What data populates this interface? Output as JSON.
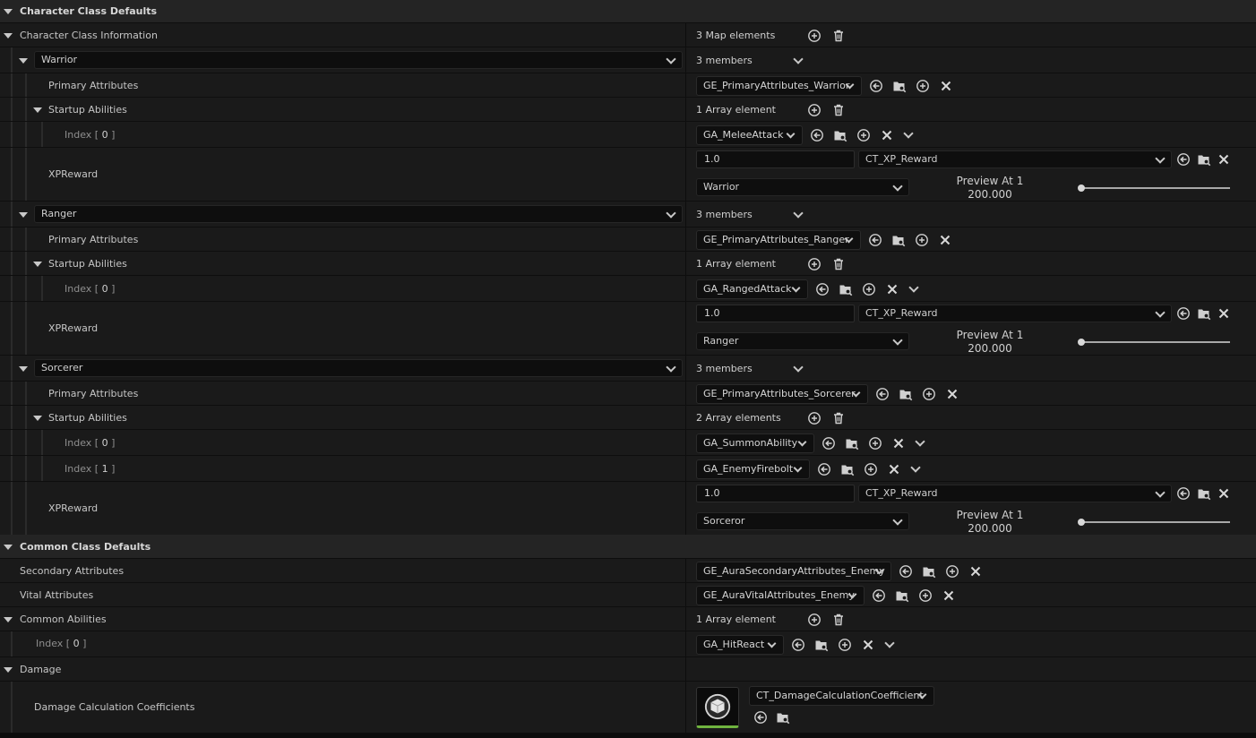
{
  "sections": {
    "character_class_defaults": "Character Class Defaults",
    "character_class_information": "Character Class Information",
    "character_class_information_value": "3 Map elements",
    "common_class_defaults": "Common Class Defaults",
    "damage": "Damage"
  },
  "labels": {
    "primary_attributes": "Primary Attributes",
    "startup_abilities": "Startup Abilities",
    "xp_reward": "XPReward",
    "preview_at": "Preview At 1",
    "secondary_attributes": "Secondary Attributes",
    "vital_attributes": "Vital Attributes",
    "common_abilities": "Common Abilities",
    "damage_calculation_coefficients": "Damage Calculation Coefficients",
    "index_prefix": "Index [",
    "index_suffix": "]"
  },
  "classes": [
    {
      "key": "Warrior",
      "members": "3 members",
      "primary_attributes": "GE_PrimaryAttributes_Warrior",
      "startup_count": "1 Array element",
      "abilities": [
        {
          "index": "0",
          "value": "GA_MeleeAttack"
        }
      ],
      "xp_value": "1.0",
      "curve_table": "CT_XP_Reward",
      "row_name": "Warrior",
      "preview_value": "200.000"
    },
    {
      "key": "Ranger",
      "members": "3 members",
      "primary_attributes": "GE_PrimaryAttributes_Ranger",
      "startup_count": "1 Array element",
      "abilities": [
        {
          "index": "0",
          "value": "GA_RangedAttack"
        }
      ],
      "xp_value": "1.0",
      "curve_table": "CT_XP_Reward",
      "row_name": "Ranger",
      "preview_value": "200.000"
    },
    {
      "key": "Sorcerer",
      "members": "3 members",
      "primary_attributes": "GE_PrimaryAttributes_Sorcerer",
      "startup_count": "2 Array elements",
      "abilities": [
        {
          "index": "0",
          "value": "GA_SummonAbility"
        },
        {
          "index": "1",
          "value": "GA_EnemyFirebolt"
        }
      ],
      "xp_value": "1.0",
      "curve_table": "CT_XP_Reward",
      "row_name": "Sorceror",
      "preview_value": "200.000"
    }
  ],
  "common": {
    "secondary_attributes": "GE_AuraSecondaryAttributes_Enemy",
    "vital_attributes": "GE_AuraVitalAttributes_Enemy",
    "common_abilities_count": "1 Array element",
    "abilities": [
      {
        "index": "0",
        "value": "GA_HitReact"
      }
    ]
  },
  "damage": {
    "curve_table": "CT_DamageCalculationCoefficient"
  },
  "preview_slider_fraction": 0.0,
  "colors": {
    "panel_bg": "#1a1a1a",
    "category_bg": "#242424",
    "input_bg": "#0e0e0e",
    "thumbnail_accent": "#6fb33f"
  }
}
